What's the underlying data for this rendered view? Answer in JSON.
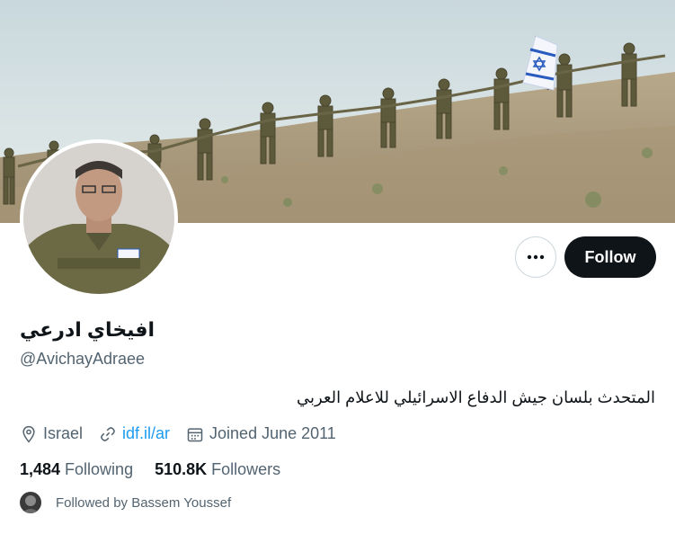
{
  "profile": {
    "display_name": "افيخاي ادرعي",
    "handle": "@AvichayAdraee",
    "bio": "المتحدث بلسان جيش الدفاع الاسرائيلي للاعلام العربي",
    "location": "Israel",
    "website": "idf.il/ar",
    "joined": "Joined June 2011"
  },
  "stats": {
    "following_count": "1,484",
    "following_label": "Following",
    "followers_count": "510.8K",
    "followers_label": "Followers"
  },
  "followed_by": "Followed by Bassem Youssef",
  "actions": {
    "follow_label": "Follow",
    "more_icon": "more-dots-icon"
  },
  "icons": {
    "location": "location-pin-icon",
    "link": "link-icon",
    "calendar": "calendar-icon"
  },
  "colors": {
    "follow_bg": "#0f1419",
    "link": "#1d9bf0",
    "secondary_text": "#536471"
  }
}
